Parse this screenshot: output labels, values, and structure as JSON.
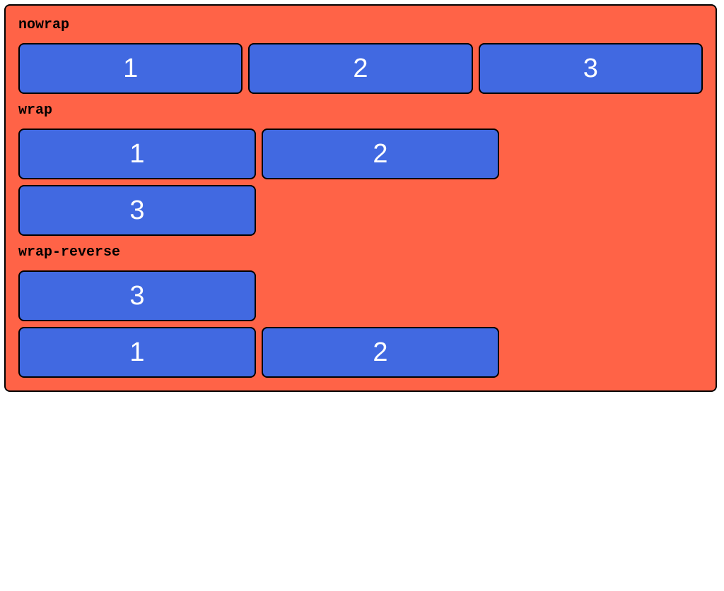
{
  "sections": {
    "nowrap": {
      "label": "nowrap",
      "items": [
        "1",
        "2",
        "3"
      ]
    },
    "wrap": {
      "label": "wrap",
      "items": [
        "1",
        "2",
        "3"
      ]
    },
    "wrapReverse": {
      "label": "wrap-reverse",
      "items": [
        "1",
        "2",
        "3"
      ]
    }
  },
  "colors": {
    "containerBg": "#ff6347",
    "boxBg": "#4169e1",
    "boxText": "#ffffff",
    "border": "#000000"
  }
}
